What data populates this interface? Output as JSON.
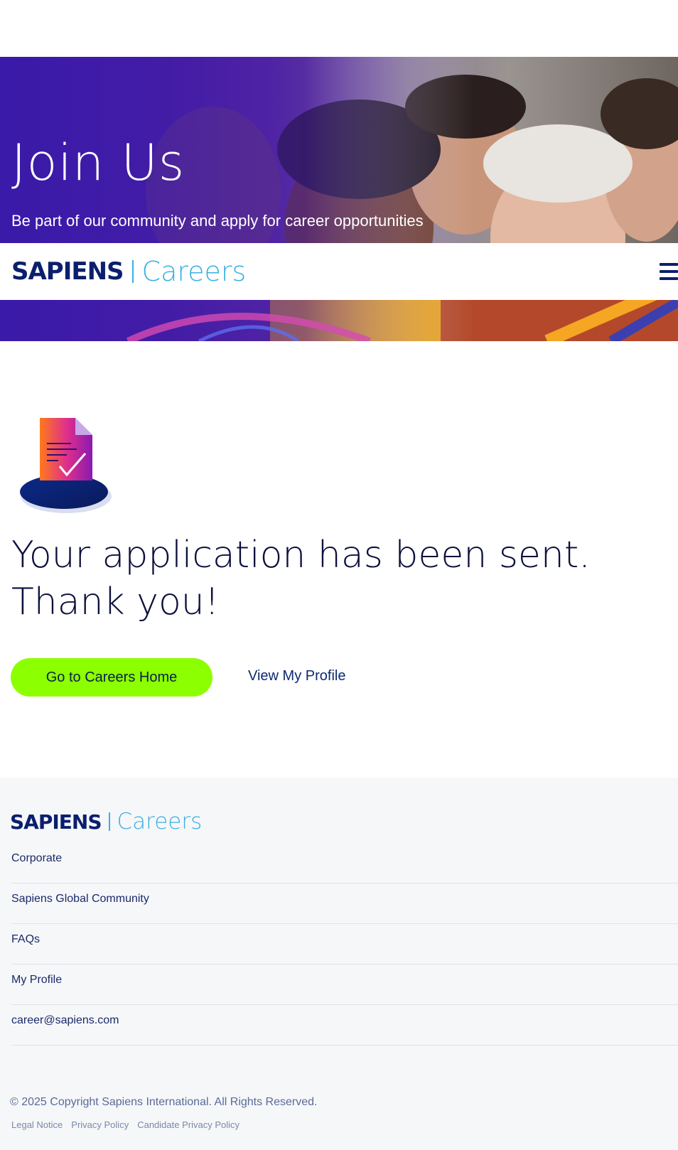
{
  "hero": {
    "title": "Join Us",
    "subtitle": "Be part of our community and apply for career opportunities"
  },
  "header": {
    "logo_brand": "SAPIENS",
    "logo_product": "Careers",
    "menu_icon": "hamburger-menu-icon"
  },
  "main": {
    "icon": "document-check-icon",
    "heading": "Your application has been sent. Thank you!",
    "primary_button": "Go to Careers Home",
    "secondary_link": "View My Profile"
  },
  "footer": {
    "logo_brand": "SAPIENS",
    "logo_product": "Careers",
    "links": [
      "Corporate",
      "Sapiens Global Community",
      "FAQs",
      "My Profile",
      "career@sapiens.com"
    ],
    "copyright": "© 2025 Copyright Sapiens International. All Rights Reserved.",
    "legal_links": [
      "Legal Notice",
      "Privacy Policy",
      "Candidate Privacy Policy"
    ]
  },
  "colors": {
    "brand_navy": "#0b1f6e",
    "brand_cyan": "#3bb0e0",
    "accent_green": "#8cff00",
    "hero_purple": "#3f18a6"
  }
}
